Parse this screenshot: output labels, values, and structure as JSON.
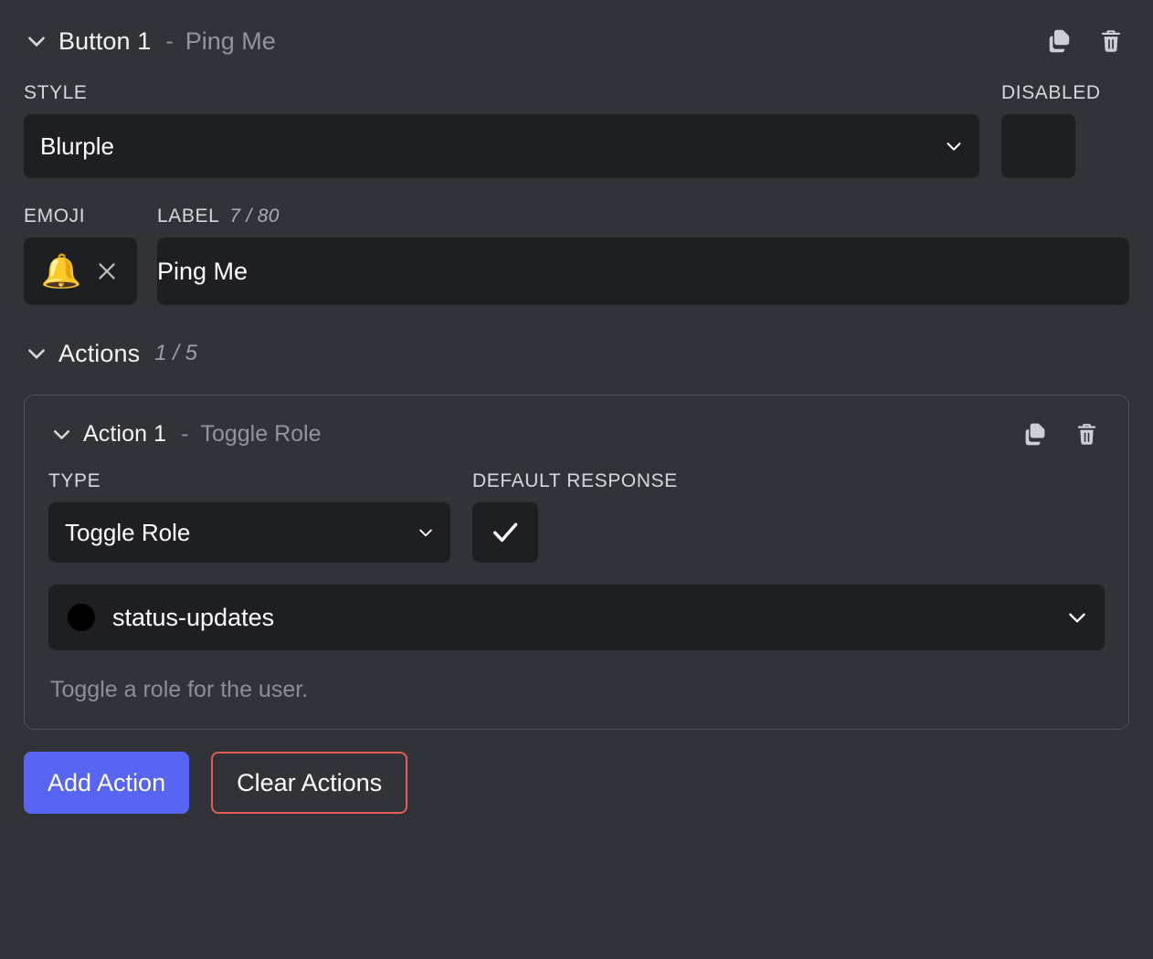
{
  "theme": {
    "background": "#313338",
    "input_background": "#1e1f22",
    "card_border": "#4d5059",
    "accent_blurple": "#5865f2",
    "danger_red": "#e35d52",
    "muted_text": "#9095a0",
    "role_dot_color": "#000000",
    "emoji_color": "#f0a93c"
  },
  "button_section": {
    "title": "Button 1",
    "separator": "-",
    "subtitle": "Ping Me",
    "collapse_icon": "chevron-down-icon",
    "duplicate_icon": "duplicate-icon",
    "delete_icon": "trash-icon"
  },
  "style_field": {
    "label": "STYLE",
    "value": "Blurple",
    "chevron_icon": "chevron-down-icon"
  },
  "disabled_field": {
    "label": "DISABLED",
    "checked": false
  },
  "emoji_field": {
    "label": "EMOJI",
    "value": "🔔",
    "clear_icon": "close-icon"
  },
  "label_field": {
    "label": "LABEL",
    "counter": "7 / 80",
    "value": "Ping Me",
    "placeholder": "Label"
  },
  "actions_section": {
    "title": "Actions",
    "counter": "1 / 5",
    "collapse_icon": "chevron-down-icon"
  },
  "action_card": {
    "title": "Action 1",
    "separator": "-",
    "subtitle": "Toggle Role",
    "collapse_icon": "chevron-down-icon",
    "duplicate_icon": "duplicate-icon",
    "delete_icon": "trash-icon",
    "type_field": {
      "label": "TYPE",
      "value": "Toggle Role",
      "chevron_icon": "chevron-down-icon"
    },
    "default_response_field": {
      "label": "DEFAULT RESPONSE",
      "checked": true,
      "check_icon": "check-icon"
    },
    "role_field": {
      "value": "status-updates",
      "dot_icon": "role-color-dot",
      "chevron_icon": "chevron-down-icon"
    },
    "description": "Toggle a role for the user."
  },
  "footer": {
    "add_action_label": "Add Action",
    "clear_actions_label": "Clear Actions"
  }
}
